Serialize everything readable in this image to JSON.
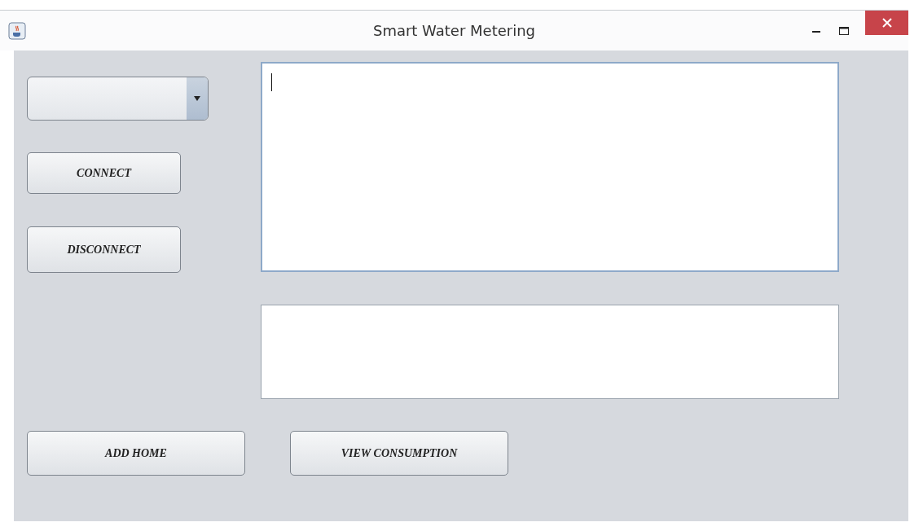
{
  "window": {
    "title": "Smart Water Metering"
  },
  "left_buttons": [
    "CONNECT",
    "DISCONNECT"
  ],
  "output_area": {
    "focused": true
  },
  "input_field": {
    "focused": false
  },
  "bottom_buttons": [
    "ADD HOME",
    "VIEW CONSUMPTION"
  ]
}
